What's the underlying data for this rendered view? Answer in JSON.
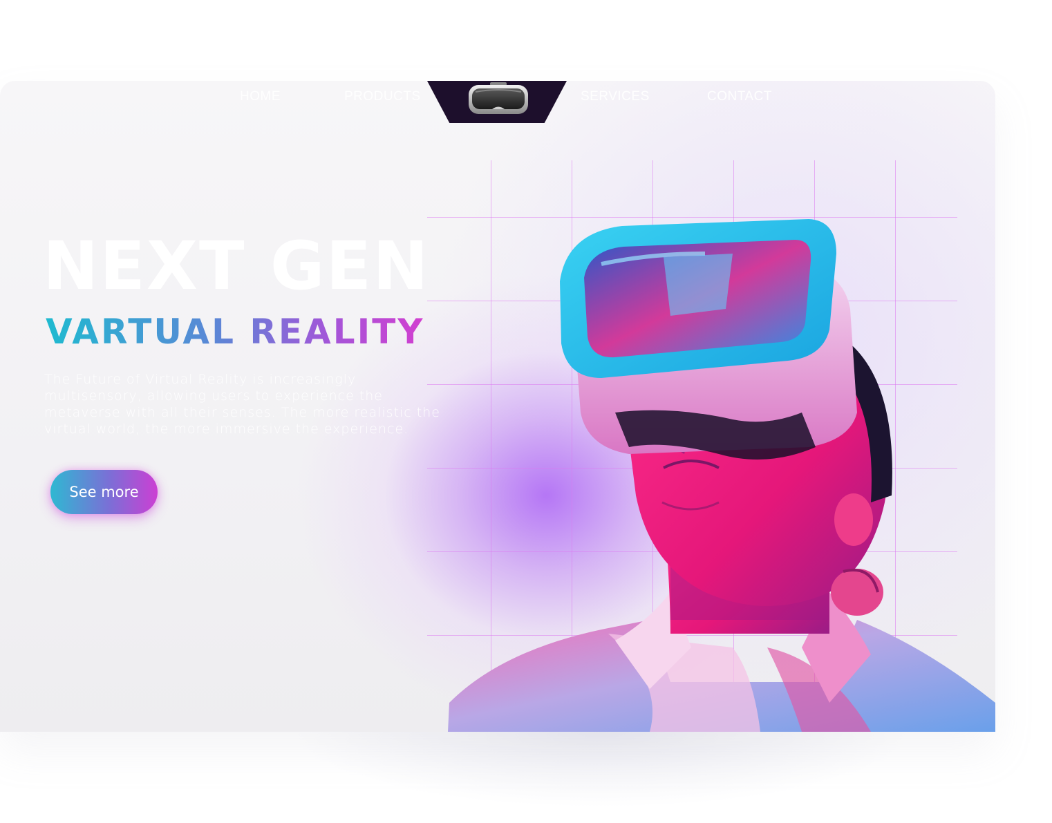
{
  "nav": {
    "items": [
      "HOME",
      "PRODUCTS",
      "SERVICES",
      "CONTACT"
    ],
    "logo_icon": "vr-headset-icon"
  },
  "hero": {
    "title": "NEXT GEN",
    "subtitle": "VARTUAL REALITY",
    "description": "The Future of Virtual Reality is increasingly multisensory, allowing users to experience the metaverse with all their senses. The more realistic the virtual world, the more immersive the experience.",
    "cta_label": "See more"
  },
  "image": {
    "subject": "person-wearing-vr-headset"
  },
  "colors": {
    "accent_teal": "#1fbad0",
    "accent_purple": "#a455d8",
    "accent_pink": "#d23fd0",
    "notch": "#1d0f2c"
  }
}
